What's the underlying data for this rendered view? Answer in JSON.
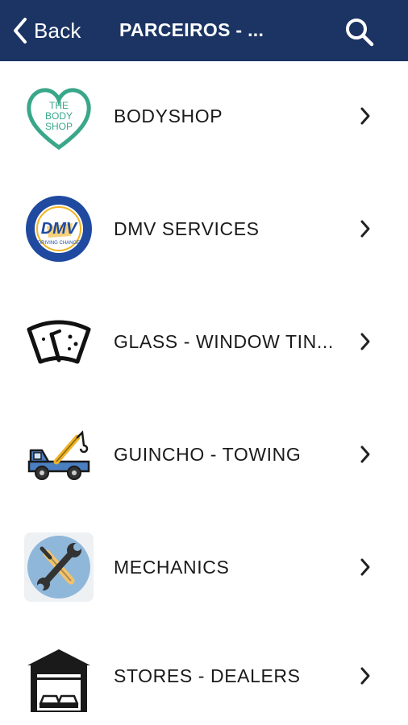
{
  "nav": {
    "back_label": "Back",
    "title": "PARCEIROS - ...",
    "bar_color": "#1b3463",
    "back_icon": "chevron-left-icon",
    "search_icon": "search-icon"
  },
  "items": [
    {
      "label": "BODYSHOP",
      "icon": "body-shop-logo"
    },
    {
      "label": "DMV SERVICES",
      "icon": "dmv-seal-logo"
    },
    {
      "label": "GLASS - WINDOW TIN...",
      "icon": "windshield-icon"
    },
    {
      "label": "GUINCHO - TOWING",
      "icon": "tow-truck-icon"
    },
    {
      "label": "MECHANICS",
      "icon": "wrench-screwdriver-icon"
    },
    {
      "label": "STORES - DEALERS",
      "icon": "dealership-garage-icon"
    }
  ],
  "logos": {
    "body_shop_text": [
      "THE",
      "BODY",
      "SHOP"
    ],
    "dmv_text": "DMV",
    "dmv_ring_top": "STATE OF CALIFORNIA",
    "dmv_ring_bottom": "DEPARTMENT OF MOTOR VEHICLES",
    "dmv_tagline": "DRIVING CHANGE"
  },
  "row_chevron_icon": "chevron-right-icon"
}
